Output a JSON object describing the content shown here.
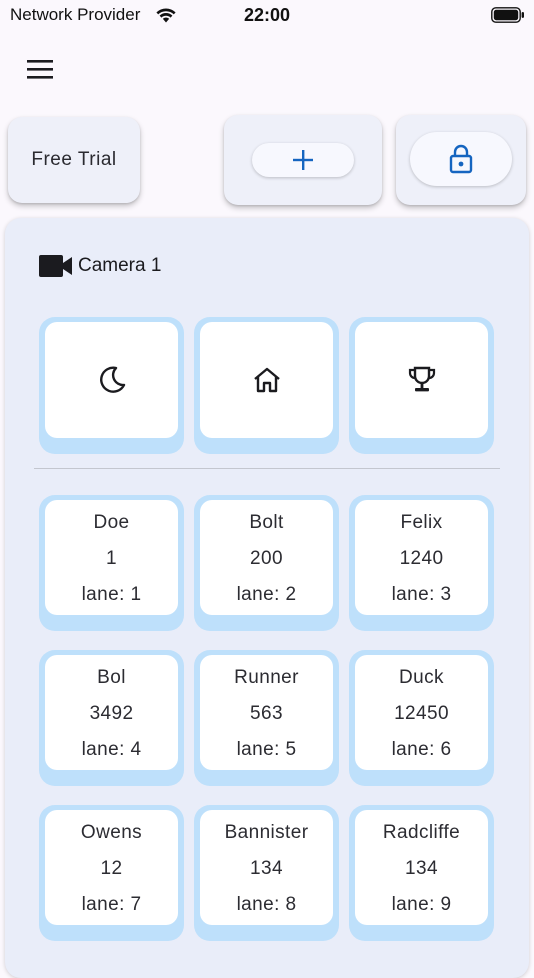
{
  "status_bar": {
    "carrier": "Network Provider",
    "time": "22:00",
    "wifi_icon": "wifi-icon",
    "battery_icon": "battery-icon"
  },
  "toolbar": {
    "menu_icon": "hamburger-menu-icon",
    "free_trial_label": "Free Trial",
    "add_icon": "plus-icon",
    "lock_icon": "lock-icon",
    "accent_color": "#1565c0"
  },
  "camera": {
    "icon": "video-camera-icon",
    "label": "Camera 1"
  },
  "modes": [
    {
      "icon": "moon-icon"
    },
    {
      "icon": "home-icon"
    },
    {
      "icon": "trophy-icon"
    }
  ],
  "lanes": [
    {
      "name": "Doe",
      "number": "1",
      "lane": "lane: 1"
    },
    {
      "name": "Bolt",
      "number": "200",
      "lane": "lane: 2"
    },
    {
      "name": "Felix",
      "number": "1240",
      "lane": "lane: 3"
    },
    {
      "name": "Bol",
      "number": "3492",
      "lane": "lane: 4"
    },
    {
      "name": "Runner",
      "number": "563",
      "lane": "lane: 5"
    },
    {
      "name": "Duck",
      "number": "12450",
      "lane": "lane: 6"
    },
    {
      "name": "Owens",
      "number": "12",
      "lane": "lane: 7"
    },
    {
      "name": "Bannister",
      "number": "134",
      "lane": "lane: 8"
    },
    {
      "name": "Radcliffe",
      "number": "134",
      "lane": "lane: 9"
    }
  ],
  "colors": {
    "tile_border": "#bee0fb",
    "panel_background": "#e9edf9",
    "card_background": "#eef0f9"
  }
}
